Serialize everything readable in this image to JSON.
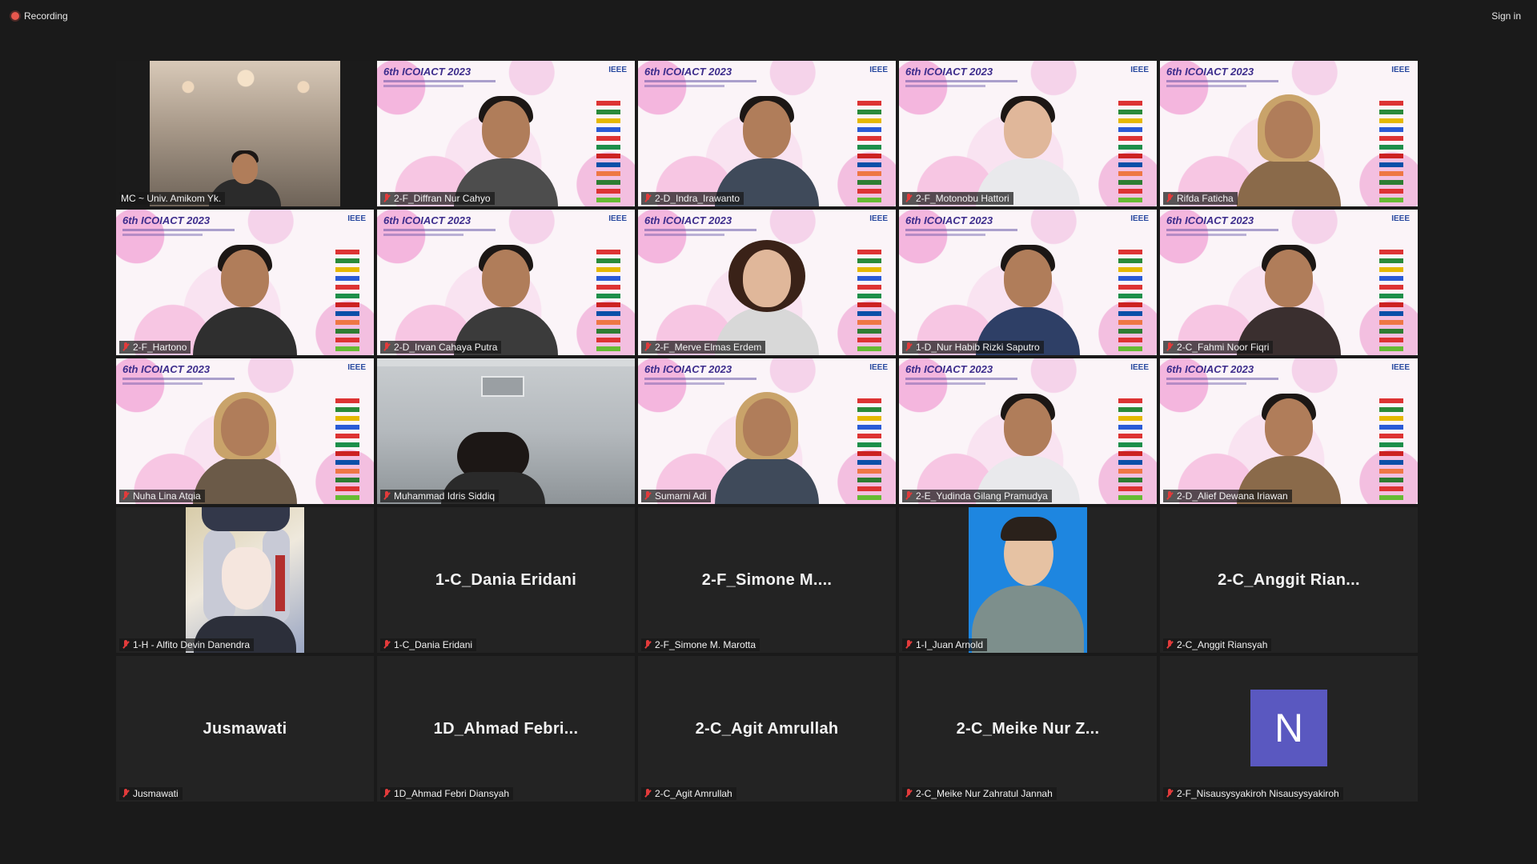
{
  "topbar": {
    "recording_label": "Recording",
    "signin_label": "Sign in"
  },
  "slide": {
    "logo_text": "6th ICOIACT 2023",
    "ieee_text": "IEEE"
  },
  "colors": {
    "active_speaker": "#b6d84f",
    "mic_muted": "#e23b3b",
    "initial_avatar": "#5a58c0",
    "background": "#1a1a1a",
    "tile": "#232323"
  },
  "participants": [
    {
      "name": "MC ~ Univ. Amikom Yk.",
      "view": "camera-room",
      "active": true,
      "muted": false
    },
    {
      "name": "2-F_Diffran Nur Cahyo",
      "view": "camera-slide",
      "muted": true
    },
    {
      "name": "2-D_Indra_Irawanto",
      "view": "camera-slide",
      "muted": true
    },
    {
      "name": "2-F_Motonobu Hattori",
      "view": "camera-slide",
      "muted": true
    },
    {
      "name": "Rifda Faticha",
      "view": "camera-slide",
      "muted": true
    },
    {
      "name": "2-F_Hartono",
      "view": "camera-slide",
      "muted": true
    },
    {
      "name": "2-D_Irvan Cahaya Putra",
      "view": "camera-slide",
      "muted": true
    },
    {
      "name": "2-F_Merve Elmas Erdem",
      "view": "camera-slide",
      "muted": true
    },
    {
      "name": "1-D_Nur Habib Rizki Saputro",
      "view": "camera-slide",
      "muted": true
    },
    {
      "name": "2-C_Fahmi Noor Fiqri",
      "view": "camera-slide",
      "muted": true
    },
    {
      "name": "Nuha Lina Atqia",
      "view": "camera-slide",
      "muted": true
    },
    {
      "name": "Muhammad Idris Siddiq",
      "view": "camera-office",
      "muted": true
    },
    {
      "name": "Sumarni Adi",
      "view": "camera-slide",
      "muted": true
    },
    {
      "name": "2-E_Yudinda Gilang Pramudya",
      "view": "camera-slide",
      "muted": true
    },
    {
      "name": "2-D_Alief Dewana Iriawan",
      "view": "camera-slide",
      "muted": true
    },
    {
      "name": "1-H - Alfito Devin Danendra",
      "view": "profile-anime",
      "muted": true
    },
    {
      "name": "1-C_Dania Eridani",
      "display_name": "1-C_Dania Eridani",
      "view": "name-only",
      "muted": true
    },
    {
      "name": "2-F_Simone M. Marotta",
      "display_name": "2-F_Simone  M....",
      "view": "name-only",
      "muted": true
    },
    {
      "name": "1-I_Juan Arnold",
      "view": "profile-photo",
      "muted": true
    },
    {
      "name": "2-C_Anggit Riansyah",
      "display_name": "2-C_Anggit  Rian...",
      "view": "name-only",
      "muted": true
    },
    {
      "name": "Jusmawati",
      "display_name": "Jusmawati",
      "view": "name-only",
      "muted": true
    },
    {
      "name": "1D_Ahmad Febri Diansyah",
      "display_name": "1D_Ahmad  Febri...",
      "view": "name-only",
      "muted": true
    },
    {
      "name": "2-C_Agit Amrullah",
      "display_name": "2-C_Agit Amrullah",
      "view": "name-only",
      "muted": true
    },
    {
      "name": "2-C_Meike Nur Zahratul Jannah",
      "display_name": "2-C_Meike Nur Z...",
      "view": "name-only",
      "muted": true
    },
    {
      "name": "2-F_Nisausysyakiroh Nisausysyakiroh",
      "initial": "N",
      "view": "initial",
      "muted": true
    }
  ]
}
